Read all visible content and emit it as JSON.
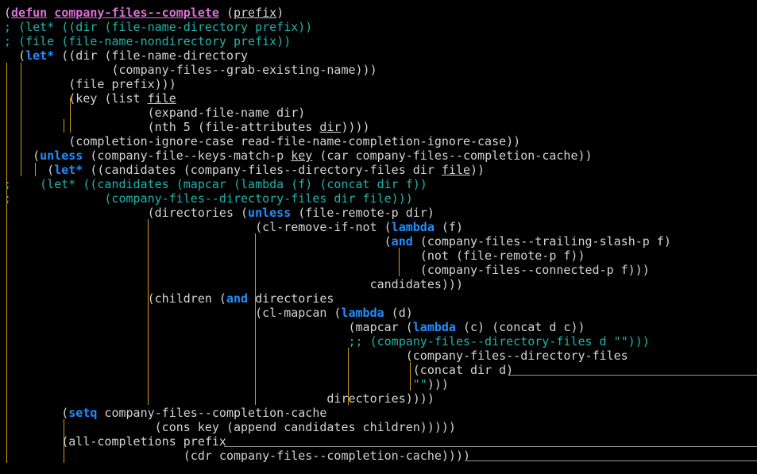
{
  "editor": {
    "language": "emacs-lisp",
    "lines": [
      {
        "tokens": [
          {
            "t": "(",
            "c": "dp"
          },
          {
            "t": "defun",
            "c": "fn"
          },
          {
            "t": " ",
            "c": "dp"
          },
          {
            "t": "company-files--complete",
            "c": "fn"
          },
          {
            "t": " (",
            "c": "dp"
          },
          {
            "t": "prefix",
            "c": "ul"
          },
          {
            "t": ")",
            "c": "dp"
          }
        ]
      },
      {
        "tokens": [
          {
            "t": "; (let* ((dir (file-name-directory prefix))",
            "c": "cm"
          }
        ]
      },
      {
        "tokens": [
          {
            "t": "; (file (file-name-nondirectory prefix))",
            "c": "cm"
          }
        ]
      },
      {
        "tokens": [
          {
            "t": "  (",
            "c": "dp"
          },
          {
            "t": "let*",
            "c": "kw"
          },
          {
            "t": " ((dir (file-name-directory",
            "c": "dp"
          }
        ]
      },
      {
        "tokens": [
          {
            "t": "               (company-files--grab-existing-name)))",
            "c": "dp"
          }
        ]
      },
      {
        "tokens": [
          {
            "t": "         (file prefix)))",
            "c": "dp"
          }
        ]
      },
      {
        "tokens": [
          {
            "t": "         (key (list ",
            "c": "dp"
          },
          {
            "t": "file",
            "c": "ul"
          }
        ]
      },
      {
        "tokens": [
          {
            "t": "                    (expand-file-name dir)",
            "c": "dp"
          }
        ]
      },
      {
        "tokens": [
          {
            "t": "                    (nth 5 (file-attributes ",
            "c": "dp"
          },
          {
            "t": "dir",
            "c": "ul"
          },
          {
            "t": "))))",
            "c": "dp"
          }
        ]
      },
      {
        "tokens": [
          {
            "t": "         (completion-ignore-case read-file-name-completion-ignore-case))",
            "c": "dp"
          }
        ]
      },
      {
        "tokens": [
          {
            "t": "    (",
            "c": "dp"
          },
          {
            "t": "unless",
            "c": "kw"
          },
          {
            "t": " (company-file--keys-match-p ",
            "c": "dp"
          },
          {
            "t": "key",
            "c": "ul"
          },
          {
            "t": " (car company-files--completion-cache))",
            "c": "dp"
          }
        ]
      },
      {
        "tokens": [
          {
            "t": "      (",
            "c": "dp"
          },
          {
            "t": "let*",
            "c": "kw"
          },
          {
            "t": " ((candidates (company-files--directory-files dir ",
            "c": "dp"
          },
          {
            "t": "file",
            "c": "ul"
          },
          {
            "t": "))",
            "c": "dp"
          }
        ]
      },
      {
        "tokens": [
          {
            "t": ";    (let* ((candidates (mapcar (lambda (f) (concat dir f))",
            "c": "cm"
          }
        ]
      },
      {
        "tokens": [
          {
            "t": ";             (company-files--directory-files dir file)))",
            "c": "cm"
          }
        ]
      },
      {
        "tokens": [
          {
            "t": "                    (directories (",
            "c": "dp"
          },
          {
            "t": "unless",
            "c": "kw"
          },
          {
            "t": " (file-remote-p dir)",
            "c": "dp"
          }
        ]
      },
      {
        "tokens": [
          {
            "t": "                                   (cl-remove-if-not (",
            "c": "dp"
          },
          {
            "t": "lambda",
            "c": "kw"
          },
          {
            "t": " (f)",
            "c": "dp"
          }
        ]
      },
      {
        "tokens": [
          {
            "t": "                                                     (",
            "c": "dp"
          },
          {
            "t": "and",
            "c": "kw"
          },
          {
            "t": " (company-files--trailing-slash-p f)",
            "c": "dp"
          }
        ]
      },
      {
        "tokens": [
          {
            "t": "                                                          (not (file-remote-p f))",
            "c": "dp"
          }
        ]
      },
      {
        "tokens": [
          {
            "t": "                                                          (company-files--connected-p f)))",
            "c": "dp"
          }
        ]
      },
      {
        "tokens": [
          {
            "t": "                                                   candidates)))",
            "c": "dp"
          }
        ]
      },
      {
        "tokens": [
          {
            "t": "                    (children (",
            "c": "dp"
          },
          {
            "t": "and",
            "c": "kw"
          },
          {
            "t": " directories",
            "c": "dp"
          }
        ]
      },
      {
        "tokens": [
          {
            "t": "                                   (cl-mapcan (",
            "c": "dp"
          },
          {
            "t": "lambda",
            "c": "kw"
          },
          {
            "t": " (d)",
            "c": "dp"
          }
        ]
      },
      {
        "tokens": [
          {
            "t": "                                                (mapcar (",
            "c": "dp"
          },
          {
            "t": "lambda",
            "c": "kw"
          },
          {
            "t": " (c) (concat d c))",
            "c": "dp"
          }
        ]
      },
      {
        "tokens": [
          {
            "t": "                                                ;; (company-files--directory-files d \"\")))",
            "c": "cm"
          }
        ]
      },
      {
        "tokens": [
          {
            "t": "                                                        (company-files--directory-files",
            "c": "dp"
          }
        ]
      },
      {
        "tokens": [
          {
            "t": "                                                         (concat dir d)",
            "c": "dp"
          }
        ]
      },
      {
        "tokens": [
          {
            "t": "                                                         ",
            "c": "dp"
          },
          {
            "t": "\"\"",
            "c": "cm"
          },
          {
            "t": ")))",
            "c": "dp"
          }
        ]
      },
      {
        "tokens": [
          {
            "t": "                                             directories))))",
            "c": "dp"
          }
        ]
      },
      {
        "tokens": [
          {
            "t": "        (",
            "c": "dp"
          },
          {
            "t": "setq",
            "c": "kw"
          },
          {
            "t": " company-files--completion-cache",
            "c": "dp"
          }
        ]
      },
      {
        "tokens": [
          {
            "t": "                     (cons key (append candidates children)))))",
            "c": "dp"
          }
        ]
      },
      {
        "tokens": [
          {
            "t": "        (all-completions prefix",
            "c": "dp"
          }
        ]
      },
      {
        "tokens": [
          {
            "t": "                         (cdr company-files--completion-cache))))",
            "c": "dp"
          }
        ]
      }
    ]
  }
}
